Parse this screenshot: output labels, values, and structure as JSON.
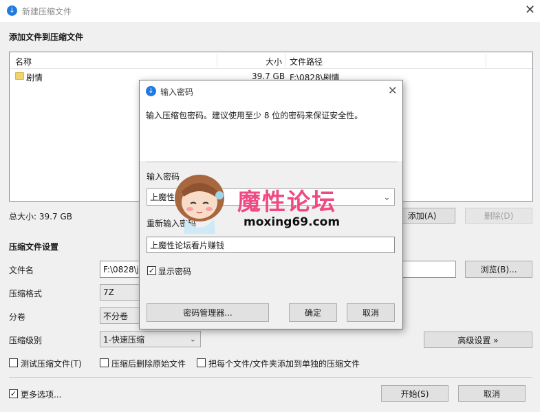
{
  "window": {
    "title": "新建压缩文件",
    "icon": "app-arrow-icon"
  },
  "add_section": {
    "heading": "添加文件到压缩文件",
    "columns": [
      "名称",
      "大小",
      "文件路径"
    ],
    "rows": [
      {
        "icon": "folder-icon",
        "name": "剧情",
        "size": "39.7 GB",
        "path": "F:\\0828\\剧情"
      }
    ],
    "total_size": "总大小: 39.7 GB",
    "add_button": "添加(A)",
    "delete_button": "删除(D)"
  },
  "settings": {
    "heading": "压缩文件设置",
    "filename_label": "文件名",
    "filename_value": "F:\\0828\\ju",
    "browse_button": "浏览(B)...",
    "format_label": "压缩格式",
    "format_value": "7Z",
    "volume_label": "分卷",
    "volume_value": "不分卷",
    "level_label": "压缩级别",
    "level_value": "1-快速压缩",
    "advanced_button": "高级设置 »",
    "options": [
      {
        "label": "测试压缩文件(T)",
        "checked": false
      },
      {
        "label": "压缩后删除原始文件",
        "checked": false
      },
      {
        "label": "把每个文件/文件夹添加到单独的压缩文件",
        "checked": false
      }
    ],
    "more_options": {
      "label": "更多选项...",
      "checked": true
    },
    "start_button": "开始(S)",
    "cancel_button": "取消"
  },
  "dialog": {
    "title": "输入密码",
    "description": "输入压缩包密码。建议使用至少 8 位的密码来保证安全性。",
    "password_label": "输入密码",
    "password_value": "上魔性论坛看片赚钱",
    "confirm_label": "重新输入密码",
    "confirm_value": "上魔性论坛看片赚钱",
    "show_password": {
      "label": "显示密码",
      "checked": true
    },
    "manager_button": "密码管理器...",
    "ok_button": "确定",
    "cancel_button": "取消"
  },
  "watermark": {
    "text": "魔性论坛",
    "url": "moxing69.com"
  },
  "colors": {
    "accent": "#1f7be0",
    "watermark_pink": "#ef4a83",
    "folder": "#f3d36e"
  }
}
